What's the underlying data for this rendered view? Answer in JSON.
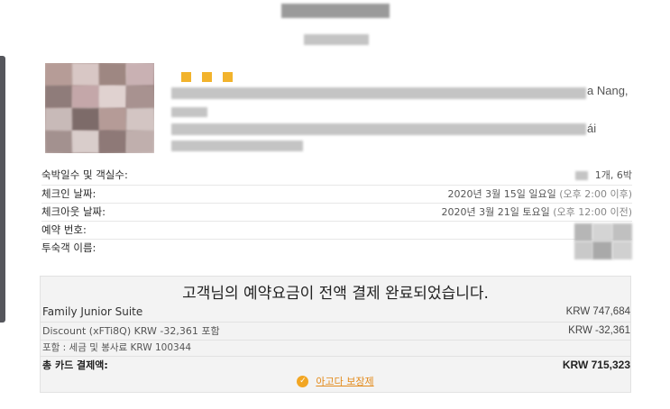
{
  "hotel": {
    "address_fragment_right": "a Nang,",
    "address_fragment_right2": "ái"
  },
  "details": {
    "nights_rooms": {
      "label": "숙박일수 및 객실수:",
      "value": "1개, 6박"
    },
    "checkin": {
      "label": "체크인 날짜:",
      "value": "2020년 3월 15일 일요일",
      "time": "(오후 2:00 이후)"
    },
    "checkout": {
      "label": "체크아웃 날짜:",
      "value": "2020년 3월 21일 토요일",
      "time": "(오후 12:00 이전)"
    },
    "booking_number": {
      "label": "예약 번호:"
    },
    "guest_name": {
      "label": "투숙객 이름:"
    }
  },
  "payment": {
    "header": "고객님의 예약요금이 전액 결제 완료되었습니다.",
    "room": {
      "label": "Family Junior Suite",
      "amount": "KRW 747,684"
    },
    "discount": {
      "label": "Discount (xFTi8Q) KRW -32,361 포함",
      "amount": "KRW -32,361"
    },
    "tax": {
      "label": "포함 : 세금 및 봉사료 KRW 100344"
    },
    "total": {
      "label": "총 카드 결제액:",
      "amount": "KRW 715,323"
    },
    "guarantee_link": "아고다 보장제"
  },
  "colors": {
    "accent": "#f2a623",
    "link": "#e38a1a",
    "sidebar": "#55565c"
  },
  "icons": {
    "guarantee": "check-circle-icon"
  }
}
